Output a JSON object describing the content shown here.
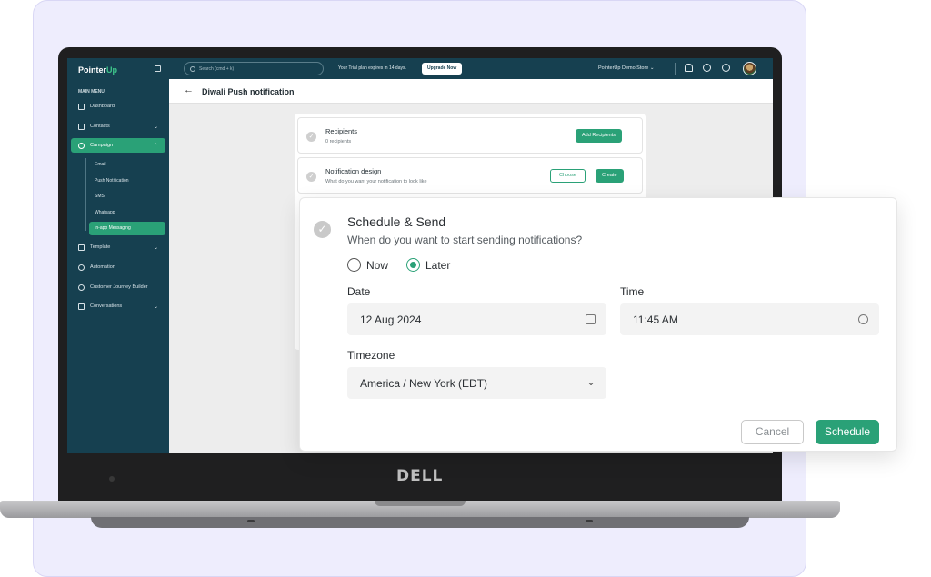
{
  "app": {
    "logo_prefix": "Pointer",
    "logo_suffix": "Up",
    "menu_title": "MAIN MENU"
  },
  "sidebar": {
    "items": [
      {
        "label": "Dashboard",
        "icon": "dashboard-icon"
      },
      {
        "label": "Contacts",
        "icon": "phone-icon"
      },
      {
        "label": "Campaign",
        "icon": "campaign-icon"
      },
      {
        "label": "Template",
        "icon": "template-icon"
      },
      {
        "label": "Automation",
        "icon": "automation-icon"
      },
      {
        "label": "Customer Journey Builder",
        "icon": "journey-icon"
      },
      {
        "label": "Conversations",
        "icon": "conversations-icon"
      }
    ],
    "campaign_subitems": [
      "Email",
      "Push Notification",
      "SMS",
      "Whatsapp",
      "In-app Messaging"
    ]
  },
  "topbar": {
    "search_placeholder": "Search (cmd + k)",
    "trial_text": "Your Trial plan expires in 14 days.",
    "upgrade_label": "Upgrade Now",
    "store_label": "PointerUp Demo Store"
  },
  "page": {
    "title": "Diwali Push notification"
  },
  "steps": {
    "recipients_title": "Recipients",
    "recipients_sub": "0 recipients",
    "add_recipients": "Add Recipients",
    "design_title": "Notification design",
    "design_sub": "What do you want your notification to look like",
    "choose": "Choose",
    "create": "Create"
  },
  "modal": {
    "title": "Schedule & Send",
    "subtitle": "When do you want to start sending notifications?",
    "option_now": "Now",
    "option_later": "Later",
    "selected_option": "Later",
    "date_label": "Date",
    "date_value": "12 Aug 2024",
    "time_label": "Time",
    "time_value": "11:45 AM",
    "timezone_label": "Timezone",
    "timezone_value": "America / New York (EDT)",
    "cancel": "Cancel",
    "schedule": "Schedule"
  },
  "device": {
    "brand": "DELL"
  },
  "colors": {
    "accent": "#2aa177",
    "sidebar": "#164050",
    "backdrop": "#eeedfd"
  }
}
